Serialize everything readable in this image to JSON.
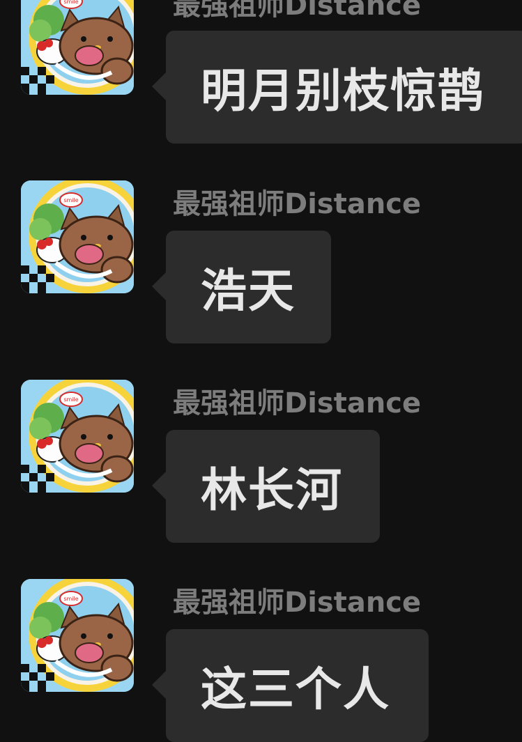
{
  "messages": [
    {
      "sender": "最强祖师Distance",
      "text": "明月别枝惊鹊",
      "avatar_icon": "hello-kitty-avatar-icon"
    },
    {
      "sender": "最强祖师Distance",
      "text": "浩天",
      "avatar_icon": "hello-kitty-avatar-icon"
    },
    {
      "sender": "最强祖师Distance",
      "text": "林长河",
      "avatar_icon": "hello-kitty-avatar-icon"
    },
    {
      "sender": "最强祖师Distance",
      "text": "这三个人",
      "avatar_icon": "hello-kitty-avatar-icon"
    }
  ],
  "avatar": {
    "badge_text": "smile"
  },
  "colors": {
    "background": "#111111",
    "bubble": "#2c2c2c",
    "bubble_text": "#e8e8e8",
    "sender_text": "#7d7d7d"
  }
}
